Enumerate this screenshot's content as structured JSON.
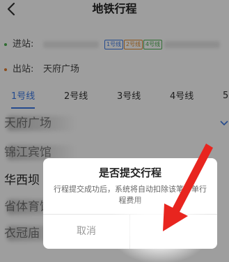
{
  "header": {
    "title": "地铁行程"
  },
  "stations": {
    "entry_label": "进站:",
    "entry_badges": [
      "1号线",
      "2号线",
      "4号线"
    ],
    "exit_label": "出站:",
    "exit_value": "天府广场"
  },
  "tabs": {
    "items": [
      "1号线",
      "2号线",
      "3号线",
      "4号线"
    ],
    "overflow": "5"
  },
  "station_list": [
    "天府广场",
    "锦江宾馆",
    "华西坝",
    "省体育馆",
    "衣冠庙"
  ],
  "dialog": {
    "title": "是否提交行程",
    "message": "行程提交成功后，系统将自动扣除该笔订单行程费用",
    "cancel_label": "取消"
  },
  "colors": {
    "accent": "#3a78e4",
    "line1": "#3a78e4",
    "line2": "#e08a2c",
    "line4": "#4caf50",
    "entry_dot": "#4caf50",
    "exit_dot": "#e07b2e",
    "annotation_arrow": "#e8251f"
  },
  "icons": {
    "back": "chevron-left-icon",
    "expand": "chevron-down-icon",
    "annotation": "arrow-icon"
  }
}
